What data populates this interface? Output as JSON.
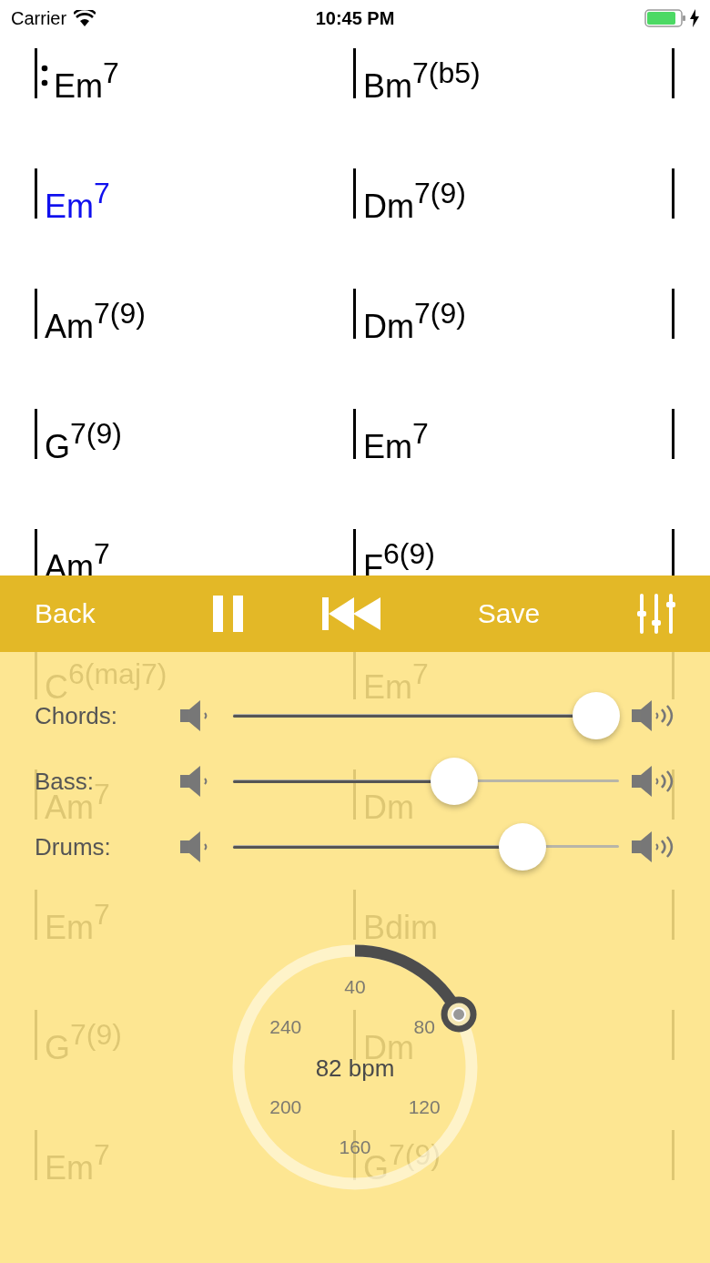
{
  "status_bar": {
    "carrier": "Carrier",
    "time": "10:45 PM"
  },
  "chart": {
    "rows": [
      {
        "bars": [
          {
            "chord": "Em$^{7}$",
            "current": false,
            "repeat_start": true
          },
          {
            "chord": "Bm$^{7(b5)}$",
            "current": false,
            "repeat_start": false
          }
        ]
      },
      {
        "bars": [
          {
            "chord": "Em$^{7}$",
            "current": true,
            "repeat_start": false
          },
          {
            "chord": "Dm$^{7(9)}$",
            "current": false,
            "repeat_start": false
          }
        ]
      },
      {
        "bars": [
          {
            "chord": "Am$^{7(9)}$",
            "current": false,
            "repeat_start": false
          },
          {
            "chord": "Dm$^{7(9)}$",
            "current": false,
            "repeat_start": false
          }
        ]
      },
      {
        "bars": [
          {
            "chord": "G$^{7(9)}$",
            "current": false,
            "repeat_start": false
          },
          {
            "chord": "Em$^{7}$",
            "current": false,
            "repeat_start": false
          }
        ]
      },
      {
        "bars": [
          {
            "chord": "Am$^{7}$",
            "current": false,
            "repeat_start": false
          },
          {
            "chord": "F$^{6(9)}$",
            "current": false,
            "repeat_start": false
          }
        ]
      },
      {
        "bars": [
          {
            "chord": "C$^{6(maj7)}$",
            "current": false,
            "repeat_start": false
          },
          {
            "chord": "Em$^{7}$",
            "current": false,
            "repeat_start": false
          }
        ]
      },
      {
        "bars": [
          {
            "chord": "Am$^{7}$",
            "current": false,
            "repeat_start": false
          },
          {
            "chord": "Dm",
            "current": false,
            "repeat_start": false
          }
        ]
      },
      {
        "bars": [
          {
            "chord": "Em$^{7}$",
            "current": false,
            "repeat_start": false
          },
          {
            "chord": "Bdim",
            "current": false,
            "repeat_start": false
          }
        ]
      },
      {
        "bars": [
          {
            "chord": "G$^{7(9)}$",
            "current": false,
            "repeat_start": false
          },
          {
            "chord": "Dm",
            "current": false,
            "repeat_start": false
          }
        ]
      },
      {
        "bars": [
          {
            "chord": "Em$^{7}$",
            "current": false,
            "repeat_start": false
          },
          {
            "chord": "G$^{7(9)}$",
            "current": false,
            "repeat_start": false
          }
        ]
      }
    ]
  },
  "toolbar": {
    "items": [
      {
        "kind": "text",
        "label": "Back"
      },
      {
        "kind": "pause"
      },
      {
        "kind": "rewind"
      },
      {
        "kind": "text",
        "label": "Save"
      },
      {
        "kind": "mixer"
      }
    ]
  },
  "mixer": {
    "channels": [
      {
        "label": "Chords:",
        "level": 0.94
      },
      {
        "label": "Bass:",
        "level": 0.574
      },
      {
        "label": "Drums:",
        "level": 0.75
      }
    ]
  },
  "tempo": {
    "readout": "82 bpm",
    "level": 0.175,
    "ticks": [
      "40",
      "80",
      "120",
      "160",
      "200",
      "240"
    ]
  }
}
